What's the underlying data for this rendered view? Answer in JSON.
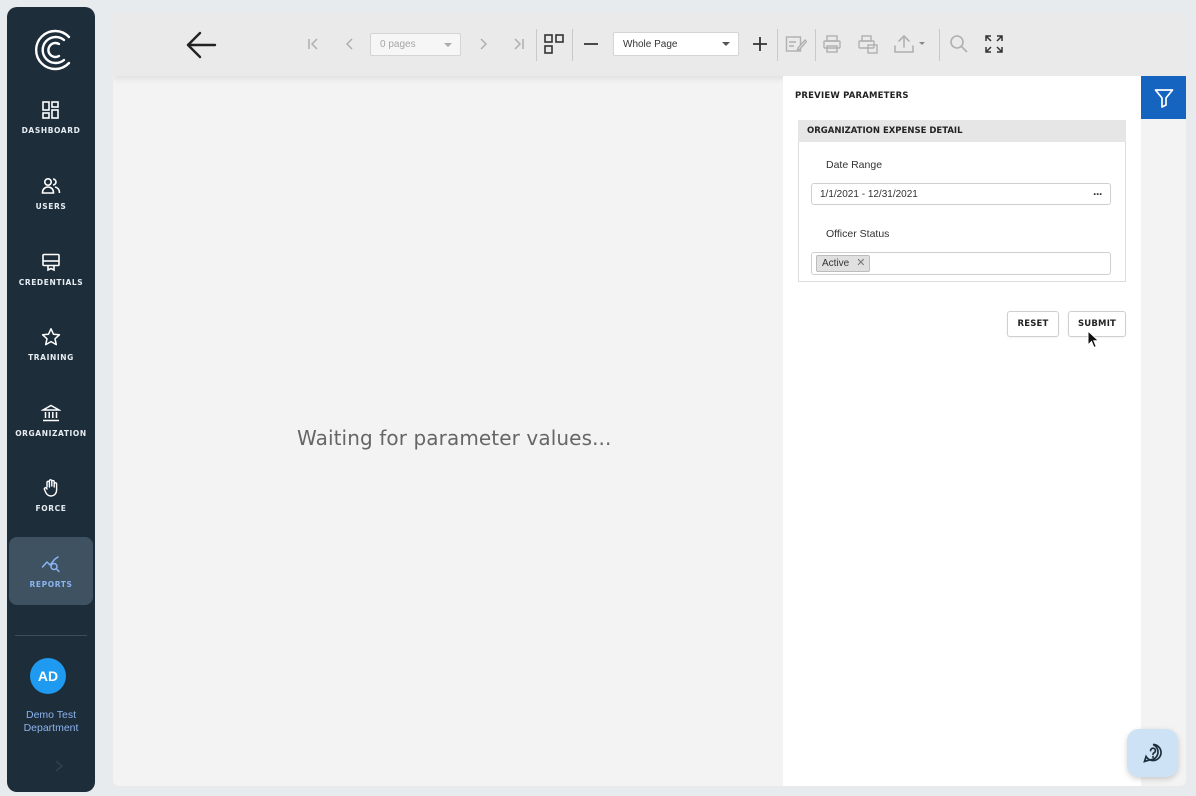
{
  "sidebar": {
    "items": [
      {
        "label": "DASHBOARD",
        "icon": "dashboard-icon"
      },
      {
        "label": "USERS",
        "icon": "users-icon"
      },
      {
        "label": "CREDENTIALS",
        "icon": "credentials-icon"
      },
      {
        "label": "TRAINING",
        "icon": "star-icon"
      },
      {
        "label": "ORGANIZATION",
        "icon": "bank-icon"
      },
      {
        "label": "FORCE",
        "icon": "hand-icon"
      },
      {
        "label": "REPORTS",
        "icon": "reports-icon",
        "active": true
      }
    ],
    "user": {
      "initials": "AD",
      "department_line1": "Demo Test",
      "department_line2": "Department"
    }
  },
  "toolbar": {
    "pages_select": "0 pages",
    "zoom_select": "Whole Page"
  },
  "viewer": {
    "waiting_message": "Waiting for parameter values..."
  },
  "params": {
    "title": "PREVIEW PARAMETERS",
    "group_title": "ORGANIZATION EXPENSE DETAIL",
    "date_range_label": "Date Range",
    "date_range_value": "1/1/2021 - 12/31/2021",
    "date_range_button": "···",
    "officer_status_label": "Officer Status",
    "officer_status_tags": [
      "Active"
    ],
    "reset_label": "RESET",
    "submit_label": "SUBMIT"
  },
  "colors": {
    "sidebar_bg": "#1e2d3a",
    "accent": "#1565c0",
    "avatar": "#1e9bf0",
    "active_label": "#8ab4f0"
  }
}
